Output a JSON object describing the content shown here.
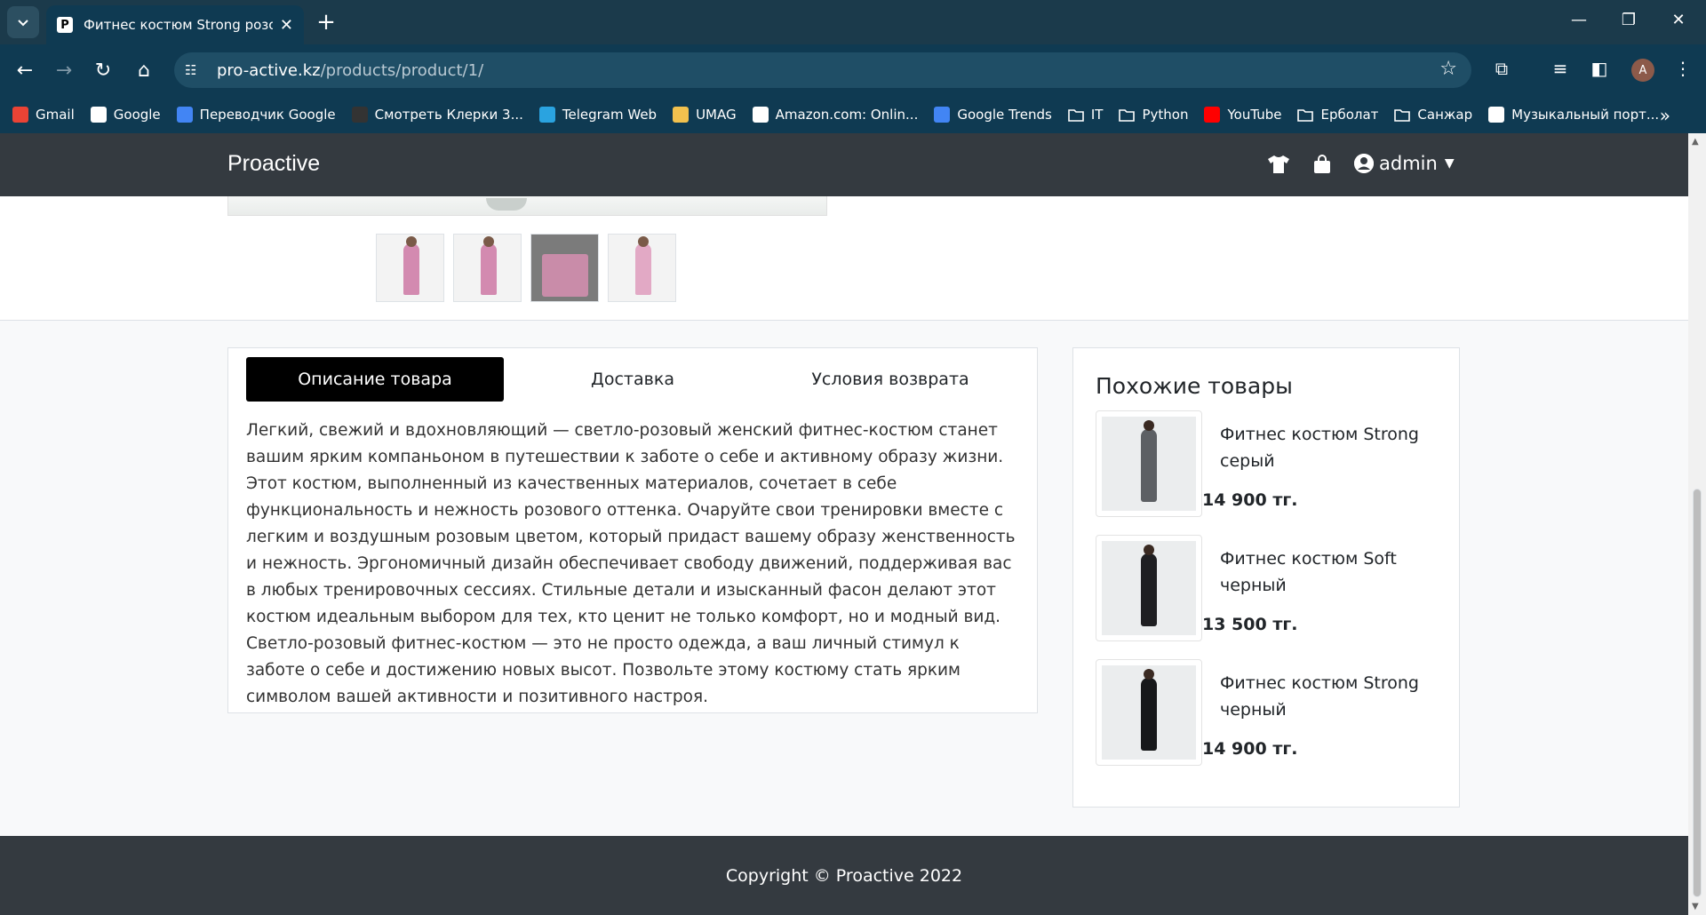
{
  "browser": {
    "tab_title": "Фитнес костюм Strong розовый",
    "tab_close": "✕",
    "new_tab": "+",
    "url_host": "pro-active.kz",
    "url_path": "/products/product/1/",
    "avatar_letter": "A"
  },
  "bookmarks": [
    {
      "label": "Gmail",
      "icon": "gmail-icon",
      "color": "#ea4335"
    },
    {
      "label": "Google",
      "icon": "google-icon",
      "color": "#ffffff"
    },
    {
      "label": "Переводчик Google",
      "icon": "translate-icon",
      "color": "#4285f4"
    },
    {
      "label": "Смотреть Клерки 3...",
      "icon": "hd-icon",
      "color": "#333333"
    },
    {
      "label": "Telegram Web",
      "icon": "telegram-icon",
      "color": "#2aa3e0"
    },
    {
      "label": "UMAG",
      "icon": "umag-icon",
      "color": "#f2c14e"
    },
    {
      "label": "Amazon.com: Onlin...",
      "icon": "amazon-icon",
      "color": "#ffffff"
    },
    {
      "label": "Google Trends",
      "icon": "trends-icon",
      "color": "#4285f4"
    },
    {
      "label": "IT",
      "icon": "folder-icon",
      "color": "#0f3a52"
    },
    {
      "label": "Python",
      "icon": "folder-icon",
      "color": "#0f3a52"
    },
    {
      "label": "YouTube",
      "icon": "youtube-icon",
      "color": "#ff0000"
    },
    {
      "label": "Ерболат",
      "icon": "folder-icon",
      "color": "#0f3a52"
    },
    {
      "label": "Санжар",
      "icon": "folder-icon",
      "color": "#0f3a52"
    },
    {
      "label": "Музыкальный порт...",
      "icon": "gt-icon",
      "color": "#ffffff"
    }
  ],
  "site": {
    "brand": "Proactive",
    "user": "admin"
  },
  "product_tabs": {
    "description": "Описание товара",
    "delivery": "Доставка",
    "returns": "Условия возврата"
  },
  "description_text": "Легкий, свежий и вдохновляющий — светло-розовый женский фитнес-костюм станет вашим ярким компаньоном в путешествии к заботе о себе и активному образу жизни. Этот костюм, выполненный из качественных материалов, сочетает в себе функциональность и нежность розового оттенка. Очаруйте свои тренировки вместе с легким и воздушным розовым цветом, который придаст вашему образу женственность и нежность. Эргономичный дизайн обеспечивает свободу движений, поддерживая вас в любых тренировочных сессиях. Стильные детали и изысканный фасон делают этот костюм идеальным выбором для тех, кто ценит не только комфорт, но и модный вид. Светло-розовый фитнес-костюм — это не просто одежда, а ваш личный стимул к заботе о себе и достижению новых высот. Позвольте этому костюму стать ярким символом вашей активности и позитивного настроя.",
  "similar": {
    "title": "Похожие товары",
    "items": [
      {
        "name": "Фитнес костюм Strong серый",
        "price": "14 900 тг.",
        "color": "#5d6064"
      },
      {
        "name": "Фитнес костюм Soft черный",
        "price": "13 500 тг.",
        "color": "#1f1f22"
      },
      {
        "name": "Фитнес костюм Strong черный",
        "price": "14 900 тг.",
        "color": "#17181a"
      }
    ]
  },
  "footer": "Copyright © Proactive 2022"
}
